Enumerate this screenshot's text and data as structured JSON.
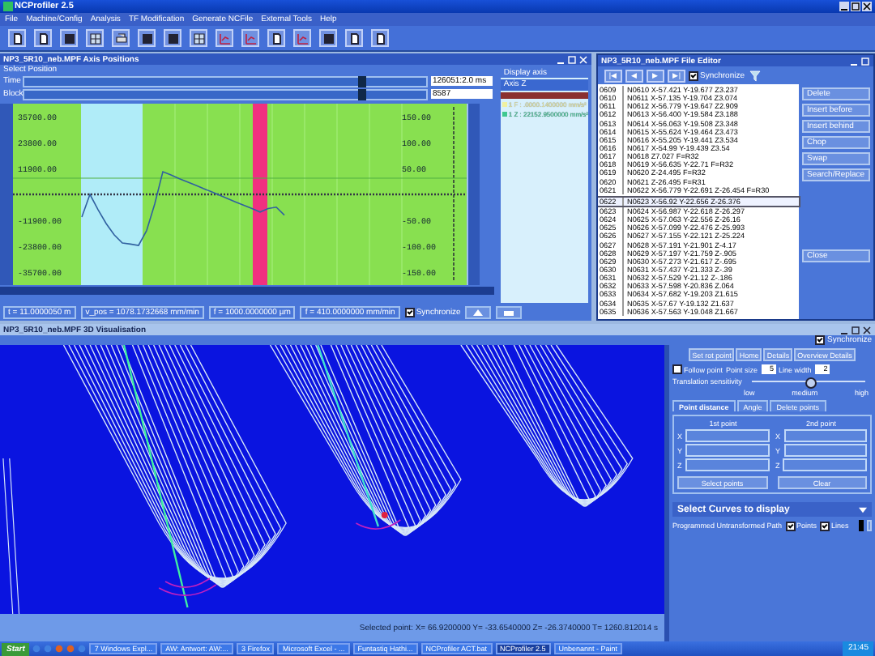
{
  "window": {
    "title": "NCProfiler 2.5"
  },
  "menu": [
    "File",
    "Machine/Config",
    "Analysis",
    "TF Modification",
    "Generate NCFile",
    "External Tools",
    "Help"
  ],
  "axis_window": {
    "title": "NP3_5R10_neb.MPF Axis Positions",
    "section": "Select Position",
    "sliders": [
      {
        "label": "Time",
        "level": 0.84,
        "value": "126051:2.0 ms"
      },
      {
        "label": "Block",
        "level": 0.84,
        "value": "8587"
      }
    ],
    "chart_data": {
      "type": "line",
      "ylim": [
        -41650,
        41650
      ],
      "yticks": [
        {
          "value": 35700,
          "label": "35700.00"
        },
        {
          "value": 23800,
          "label": "23800.00"
        },
        {
          "value": 11900,
          "label": "11900.00"
        },
        {
          "value": -11900,
          "label": "-11900.00"
        },
        {
          "value": -23800,
          "label": "-23800.00"
        },
        {
          "value": -35700,
          "label": "-35700.00"
        }
      ],
      "categories": [
        null,
        null,
        null,
        null,
        null,
        null,
        null,
        null,
        null,
        null,
        null,
        null,
        null,
        null,
        null,
        null,
        null,
        null,
        null,
        null,
        null,
        null,
        null,
        null,
        null,
        null,
        null,
        null,
        null,
        null,
        null,
        null,
        null,
        null,
        null,
        null,
        null,
        null,
        null,
        null,
        null,
        null,
        null,
        null,
        null,
        null,
        null,
        null,
        null,
        null,
        null,
        null,
        null,
        null,
        null,
        null
      ],
      "ref_lines": [
        {
          "axis": "y",
          "value": 0,
          "color": "#333344"
        },
        {
          "axis": "y",
          "value": 7440,
          "color": "#50b040"
        }
      ],
      "series": [
        {
          "color": "#3060a0",
          "values": [
            null,
            null,
            null,
            null,
            null,
            null,
            null,
            null,
            -10400,
            0,
            -7000,
            -13400,
            -18600,
            -22300,
            -22800,
            -23400,
            -16600,
            -4400,
            10400,
            8900,
            7300,
            5800,
            4300,
            2700,
            1200,
            -400,
            -1900,
            -3500,
            -5000,
            -6500,
            -8100,
            -6500,
            -5900,
            -9500,
            null,
            null,
            null,
            null,
            null,
            null,
            null,
            null,
            null,
            null,
            null,
            null,
            null,
            null,
            null,
            null,
            null,
            null,
            null,
            null,
            null,
            null
          ]
        }
      ]
    },
    "right_ticks": [
      "150.00",
      "100.00",
      "50.00",
      "-50.00",
      "-100.00",
      "-150.00"
    ],
    "display_axis": {
      "label": "Display axis",
      "value": "Axis Z",
      "items": [
        {
          "text": "1 F : .0000.1400000 mm/s²",
          "color": "#f0f0a0"
        },
        {
          "text": "1 Z : 22152.9500000 mm/s²",
          "color": "#40c890"
        }
      ]
    },
    "status_fields": [
      "t = 11.0000050 m",
      "v_pos = 1078.1732668 mm/min",
      "f = 1000.0000000 µm",
      "f = 410.0000000 mm/min"
    ],
    "synchronize": {
      "label": "Synchronize",
      "checked": true
    }
  },
  "file_editor": {
    "title": "NP3_5R10_neb.MPF File Editor",
    "nav_buttons": [
      "|◀",
      "◀",
      "▶",
      "▶|"
    ],
    "synchronize": {
      "label": "Synchronize",
      "checked": true
    },
    "lines": [
      {
        "number": "0609",
        "code": "N0610 X-57.421 Y-19.677 Z3.237",
        "selected": false
      },
      {
        "number": "0610",
        "code": "N0611 X-57.135 Y-19.704 Z3.074",
        "selected": false
      },
      {
        "number": "0611",
        "code": "N0612 X-56.779 Y-19.647 Z2.909",
        "selected": false
      },
      {
        "number": "0612",
        "code": "N0613 X-56.400 Y-19.584 Z3.188",
        "selected": false
      },
      {
        "number": "0613",
        "code": "N0614 X-56.063 Y-19.508 Z3.348",
        "selected": false
      },
      {
        "number": "0614",
        "code": "N0615 X-55.624 Y-19.464 Z3.473",
        "selected": false
      },
      {
        "number": "0615",
        "code": "N0616 X-55.205 Y-19.441 Z3.534",
        "selected": false
      },
      {
        "number": "0616",
        "code": "N0617 X-54.99 Y-19.439 Z3.54",
        "selected": false
      },
      {
        "number": "0617",
        "code": "N0618 Z7.027 F=R32",
        "selected": false
      },
      {
        "number": "0618",
        "code": "N0619 X-56.635 Y-22.71 F=R32",
        "selected": false
      },
      {
        "number": "0619",
        "code": "N0620 Z-24.495 F=R32",
        "selected": false
      },
      {
        "number": "0620",
        "code": "N0621 Z-26.495 F=R31",
        "selected": false
      },
      {
        "number": "0621",
        "code": "N0622 X-56.779 Y-22.691 Z-26.454 F=R30",
        "selected": false
      },
      {
        "number": "0622",
        "code": "N0623 X-56.92 Y-22.656 Z-26.376",
        "selected": true
      },
      {
        "number": "0623",
        "code": "N0624 X-56.987 Y-22.618 Z-26.297",
        "selected": false
      },
      {
        "number": "0624",
        "code": "N0625 X-57.063 Y-22.556 Z-26.16",
        "selected": false
      },
      {
        "number": "0625",
        "code": "N0626 X-57.099 Y-22.476 Z-25.993",
        "selected": false
      },
      {
        "number": "0626",
        "code": "N0627 X-57.155 Y-22.121 Z-25.224",
        "selected": false
      },
      {
        "number": "0627",
        "code": "N0628 X-57.191 Y-21.901 Z-4.17",
        "selected": false
      },
      {
        "number": "0628",
        "code": "N0629 X-57.197 Y-21.759 Z-.905",
        "selected": false
      },
      {
        "number": "0629",
        "code": "N0630 X-57.273 Y-21.617 Z-.695",
        "selected": false
      },
      {
        "number": "0630",
        "code": "N0631 X-57.437 Y-21.333 Z-.39",
        "selected": false
      },
      {
        "number": "0631",
        "code": "N0632 X-57.529 Y-21.12 Z-.186",
        "selected": false
      },
      {
        "number": "0632",
        "code": "N0633 X-57.598 Y-20.836 Z.064",
        "selected": false
      },
      {
        "number": "0633",
        "code": "N0634 X-57.682 Y-19.203 Z1.615",
        "selected": false
      },
      {
        "number": "0634",
        "code": "N0635 X-57.67 Y-19.132 Z1.637",
        "selected": false
      },
      {
        "number": "0635",
        "code": "N0636 X-57.563 Y-19.048 Z1.667",
        "selected": false
      }
    ],
    "buttons": [
      {
        "label": "Delete",
        "kind": "top"
      },
      {
        "label": "Insert before",
        "kind": "top"
      },
      {
        "label": "Insert behind",
        "kind": "top"
      },
      {
        "label": "Chop",
        "kind": "top"
      },
      {
        "label": "Swap",
        "kind": "top"
      },
      {
        "label": "Search/Replace",
        "kind": "top"
      },
      {
        "label": "Close",
        "kind": "bottom"
      }
    ]
  },
  "visualization": {
    "title": "NP3_5R10_neb.MPF 3D Visualisation",
    "synchronize": {
      "label": "Synchronize",
      "checked": true
    },
    "status": "Selected point: X= 66.9200000 Y= -33.6540000 Z= -26.3740000 T= 1260.812014 s",
    "view_buttons": [
      "Set rot point",
      "Home",
      "Details",
      "Overview Details"
    ],
    "follow_point": {
      "label": "Follow point",
      "checked": false
    },
    "point_size": {
      "label": "Point size",
      "value": "5"
    },
    "line_width": {
      "label": "Line width",
      "value": "2"
    },
    "sensitivity": {
      "label": "Translation sensitivity",
      "level": 0.5,
      "scale": [
        "low",
        "medium",
        "high"
      ]
    },
    "tabs": [
      {
        "label": "Point distance",
        "selected": true
      },
      {
        "label": "Angle",
        "selected": false
      },
      {
        "label": "Delete points",
        "selected": false
      }
    ],
    "points": [
      {
        "heading": "1st point",
        "axes": [
          "X",
          "Y",
          "Z"
        ]
      },
      {
        "heading": "2nd point",
        "axes": [
          "X",
          "Y",
          "Z"
        ]
      }
    ],
    "point_buttons": [
      "Select points",
      "Clear"
    ],
    "curves": {
      "heading": "Select Curves to display",
      "items": [
        {
          "name": "Programmed Untransformed Path",
          "points": {
            "label": "Points",
            "checked": true
          },
          "lines": {
            "label": "Lines",
            "checked": true
          },
          "color": "#000000"
        }
      ]
    }
  },
  "taskbar": {
    "start": "Start",
    "tasks": [
      {
        "label": "7 Windows Expl...",
        "selected": false
      },
      {
        "label": "AW: Antwort: AW:...",
        "selected": false
      },
      {
        "label": "3 Firefox",
        "selected": false
      },
      {
        "label": "Microsoft Excel - ...",
        "selected": false
      },
      {
        "label": "Funtastiq Hathi...",
        "selected": false
      },
      {
        "label": "NCProfiler ACT.bat",
        "selected": false
      },
      {
        "label": "NCProfiler 2.5",
        "selected": true
      },
      {
        "label": "Unbenannt - Paint",
        "selected": false
      }
    ],
    "clock": "21:45"
  }
}
